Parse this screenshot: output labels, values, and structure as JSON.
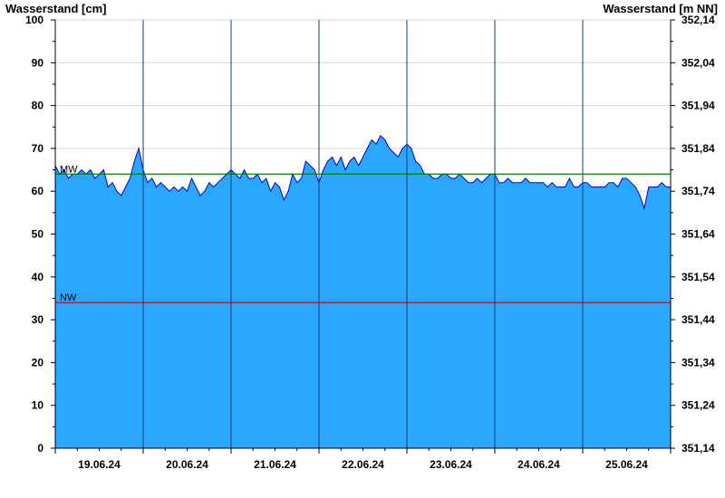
{
  "chart_data": {
    "type": "area",
    "ylabel_left": "Wasserstand [cm]",
    "ylabel_right": "Wasserstand [m NN]",
    "ylim": [
      0,
      100
    ],
    "yticks_left": [
      "0",
      "10",
      "20",
      "30",
      "40",
      "50",
      "60",
      "70",
      "80",
      "90",
      "100"
    ],
    "yticks_right": [
      "351,14",
      "351,24",
      "351,34",
      "351,44",
      "351,54",
      "351,64",
      "351,74",
      "351,84",
      "351,94",
      "352,04",
      "352,14"
    ],
    "x_dates": [
      "19.06.24",
      "20.06.24",
      "21.06.24",
      "22.06.24",
      "23.06.24",
      "24.06.24",
      "25.06.24"
    ],
    "x_range_days": [
      0.0,
      7.0
    ],
    "day_boundaries": [
      1,
      2,
      3,
      4,
      5,
      6
    ],
    "reference_lines": [
      {
        "label": "MW",
        "value": 64,
        "color": "#008000"
      },
      {
        "label": "NW",
        "value": 34,
        "color": "#cc0000"
      }
    ],
    "fill_color": "#2aa8ff",
    "line_color": "#0000cc",
    "grid": true,
    "series": [
      {
        "x": [
          0.0,
          0.05,
          0.1,
          0.15,
          0.2,
          0.25,
          0.3,
          0.35,
          0.4,
          0.45,
          0.5,
          0.55,
          0.6,
          0.65,
          0.7,
          0.75,
          0.8,
          0.85,
          0.9,
          0.95,
          1.0,
          1.05,
          1.1,
          1.15,
          1.2,
          1.25,
          1.3,
          1.35,
          1.4,
          1.45,
          1.5,
          1.55,
          1.6,
          1.65,
          1.7,
          1.75,
          1.8,
          1.85,
          1.9,
          1.95,
          2.0,
          2.05,
          2.1,
          2.15,
          2.2,
          2.25,
          2.3,
          2.35,
          2.4,
          2.45,
          2.5,
          2.55,
          2.6,
          2.65,
          2.7,
          2.75,
          2.8,
          2.85,
          2.9,
          2.95,
          3.0,
          3.05,
          3.1,
          3.15,
          3.2,
          3.25,
          3.3,
          3.35,
          3.4,
          3.45,
          3.5,
          3.55,
          3.6,
          3.65,
          3.7,
          3.75,
          3.8,
          3.85,
          3.9,
          3.95,
          4.0,
          4.05,
          4.1,
          4.15,
          4.2,
          4.25,
          4.3,
          4.35,
          4.4,
          4.45,
          4.5,
          4.55,
          4.6,
          4.65,
          4.7,
          4.75,
          4.8,
          4.85,
          4.9,
          4.95,
          5.0,
          5.05,
          5.1,
          5.15,
          5.2,
          5.25,
          5.3,
          5.35,
          5.4,
          5.45,
          5.5,
          5.55,
          5.6,
          5.65,
          5.7,
          5.75,
          5.8,
          5.85,
          5.9,
          5.95,
          6.0,
          6.05,
          6.1,
          6.15,
          6.2,
          6.25,
          6.3,
          6.35,
          6.4,
          6.45,
          6.5,
          6.55,
          6.6,
          6.65,
          6.7,
          6.75,
          6.8,
          6.85,
          6.9,
          6.95,
          7.0
        ],
        "values": [
          66,
          64,
          65,
          63,
          64,
          64,
          65,
          64,
          65,
          63,
          64,
          65,
          61,
          62,
          60,
          59,
          61,
          63,
          67,
          70,
          65,
          62,
          63,
          61,
          62,
          61,
          60,
          61,
          60,
          61,
          60,
          63,
          61,
          59,
          60,
          62,
          61,
          62,
          63,
          64,
          65,
          64,
          63,
          65,
          63,
          63,
          64,
          62,
          63,
          60,
          62,
          61,
          58,
          60,
          64,
          62,
          63,
          67,
          66,
          65,
          62,
          65,
          67,
          68,
          66,
          68,
          65,
          67,
          68,
          66,
          68,
          70,
          72,
          71,
          73,
          72,
          70,
          69,
          68,
          70,
          71,
          70,
          67,
          66,
          64,
          64,
          63,
          63,
          64,
          64,
          63,
          63,
          64,
          63,
          62,
          62,
          63,
          62,
          63,
          64,
          64,
          62,
          62,
          63,
          62,
          62,
          62,
          63,
          62,
          62,
          62,
          62,
          61,
          62,
          61,
          61,
          61,
          63,
          61,
          61,
          62,
          62,
          61,
          61,
          61,
          61,
          62,
          62,
          61,
          63,
          63,
          62,
          61,
          59,
          56,
          61,
          61,
          61,
          62,
          61,
          61
        ]
      }
    ]
  }
}
